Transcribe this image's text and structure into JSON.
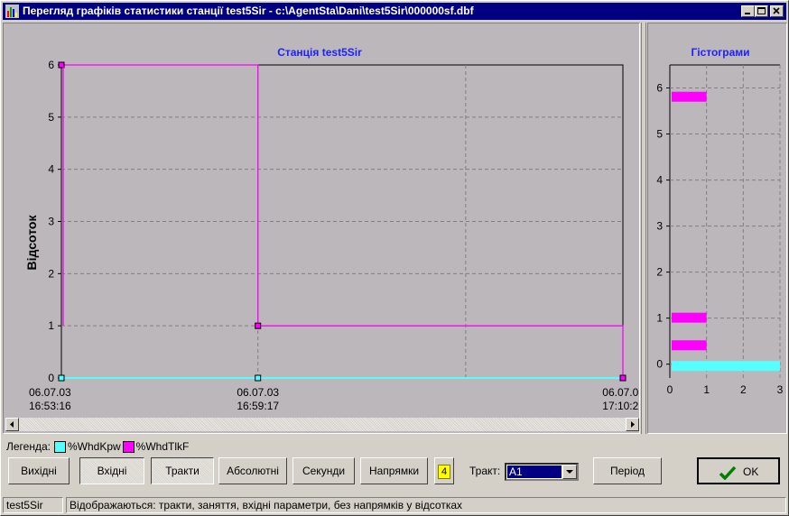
{
  "window": {
    "title": "Перегляд графіків статистики станції test5Sir - c:\\AgentSta\\Dani\\test5Sir\\000000sf.dbf"
  },
  "colors": {
    "series_cyan": "#55ffff",
    "series_magenta": "#ff00ff",
    "chart_bg": "#bbb7bb",
    "title_blue": "#2020ff",
    "titlebar": "#000080"
  },
  "chart_data": [
    {
      "type": "line",
      "title": "Станція test5Sir",
      "ylabel": "Відсоток",
      "ylim": [
        0,
        6
      ],
      "y_ticks": [
        "0",
        "1",
        "2",
        "3",
        "4",
        "5",
        "6"
      ],
      "x_ticks": [
        {
          "date": "06.07.03",
          "time": "16:53:16"
        },
        {
          "date": "06.07.03",
          "time": "16:59:17"
        },
        {
          "date": "06.07.03",
          "time": "17:10:26"
        }
      ],
      "x": [
        "06.07.03 16:53:16",
        "06.07.03 16:59:17",
        "06.07.03 17:10:26"
      ],
      "series": [
        {
          "name": "%WhdKpw",
          "values": [
            0,
            0,
            0
          ]
        },
        {
          "name": "%WhdTlkF",
          "values": [
            6,
            1,
            0
          ]
        }
      ],
      "grid": true
    },
    {
      "type": "bar",
      "title": "Гістограми",
      "orientation": "horizontal",
      "xlim": [
        0,
        3
      ],
      "x_ticks": [
        "0",
        "1",
        "2",
        "3"
      ],
      "y_ticks": [
        "0",
        "1",
        "2",
        "3",
        "4",
        "5",
        "6"
      ],
      "ylim": [
        -0.3,
        6.5
      ],
      "bars": [
        {
          "series": "%WhdTlkF",
          "level": 5.8,
          "count": 1
        },
        {
          "series": "%WhdTlkF",
          "level": 1.0,
          "count": 1
        },
        {
          "series": "%WhdTlkF",
          "level": 0.4,
          "count": 1
        },
        {
          "series": "%WhdKpw",
          "level": -0.05,
          "count": 3
        }
      ],
      "grid": true
    }
  ],
  "legend": {
    "label": "Легенда:",
    "items": [
      {
        "name": "%WhdKpw",
        "color": "#55ffff"
      },
      {
        "name": "%WhdTlkF",
        "color": "#ff00ff"
      }
    ]
  },
  "toolbar": {
    "vykhidni": "Вихідні",
    "vkhidni": "Вхідні",
    "trakty": "Тракти",
    "absoliutni": "Абсолютні",
    "sekundy": "Секунди",
    "napriamky": "Напрямки",
    "count_badge": "4",
    "trakt_label": "Тракт:",
    "trakt_value": "A1",
    "period": "Період",
    "ok": "OK"
  },
  "status": {
    "station": "test5Sir",
    "message": "Відображаються: тракти, заняття, вхідні параметри, без напрямків у відсотках"
  }
}
